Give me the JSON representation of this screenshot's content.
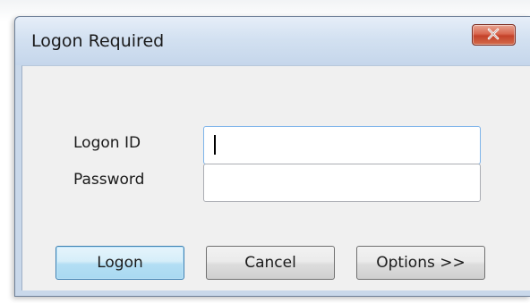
{
  "window": {
    "title": "Logon Required",
    "close_symbol": "close-icon"
  },
  "form": {
    "logon_id_label": "Logon ID",
    "logon_id_value": "",
    "password_label": "Password",
    "password_value": ""
  },
  "buttons": {
    "logon_label": "Logon",
    "cancel_label": "Cancel",
    "options_label": "Options >>"
  },
  "colors": {
    "close_button": "#c4422a",
    "default_button_accent": "#3c7fb1",
    "focus_border": "#7eb4ea"
  }
}
